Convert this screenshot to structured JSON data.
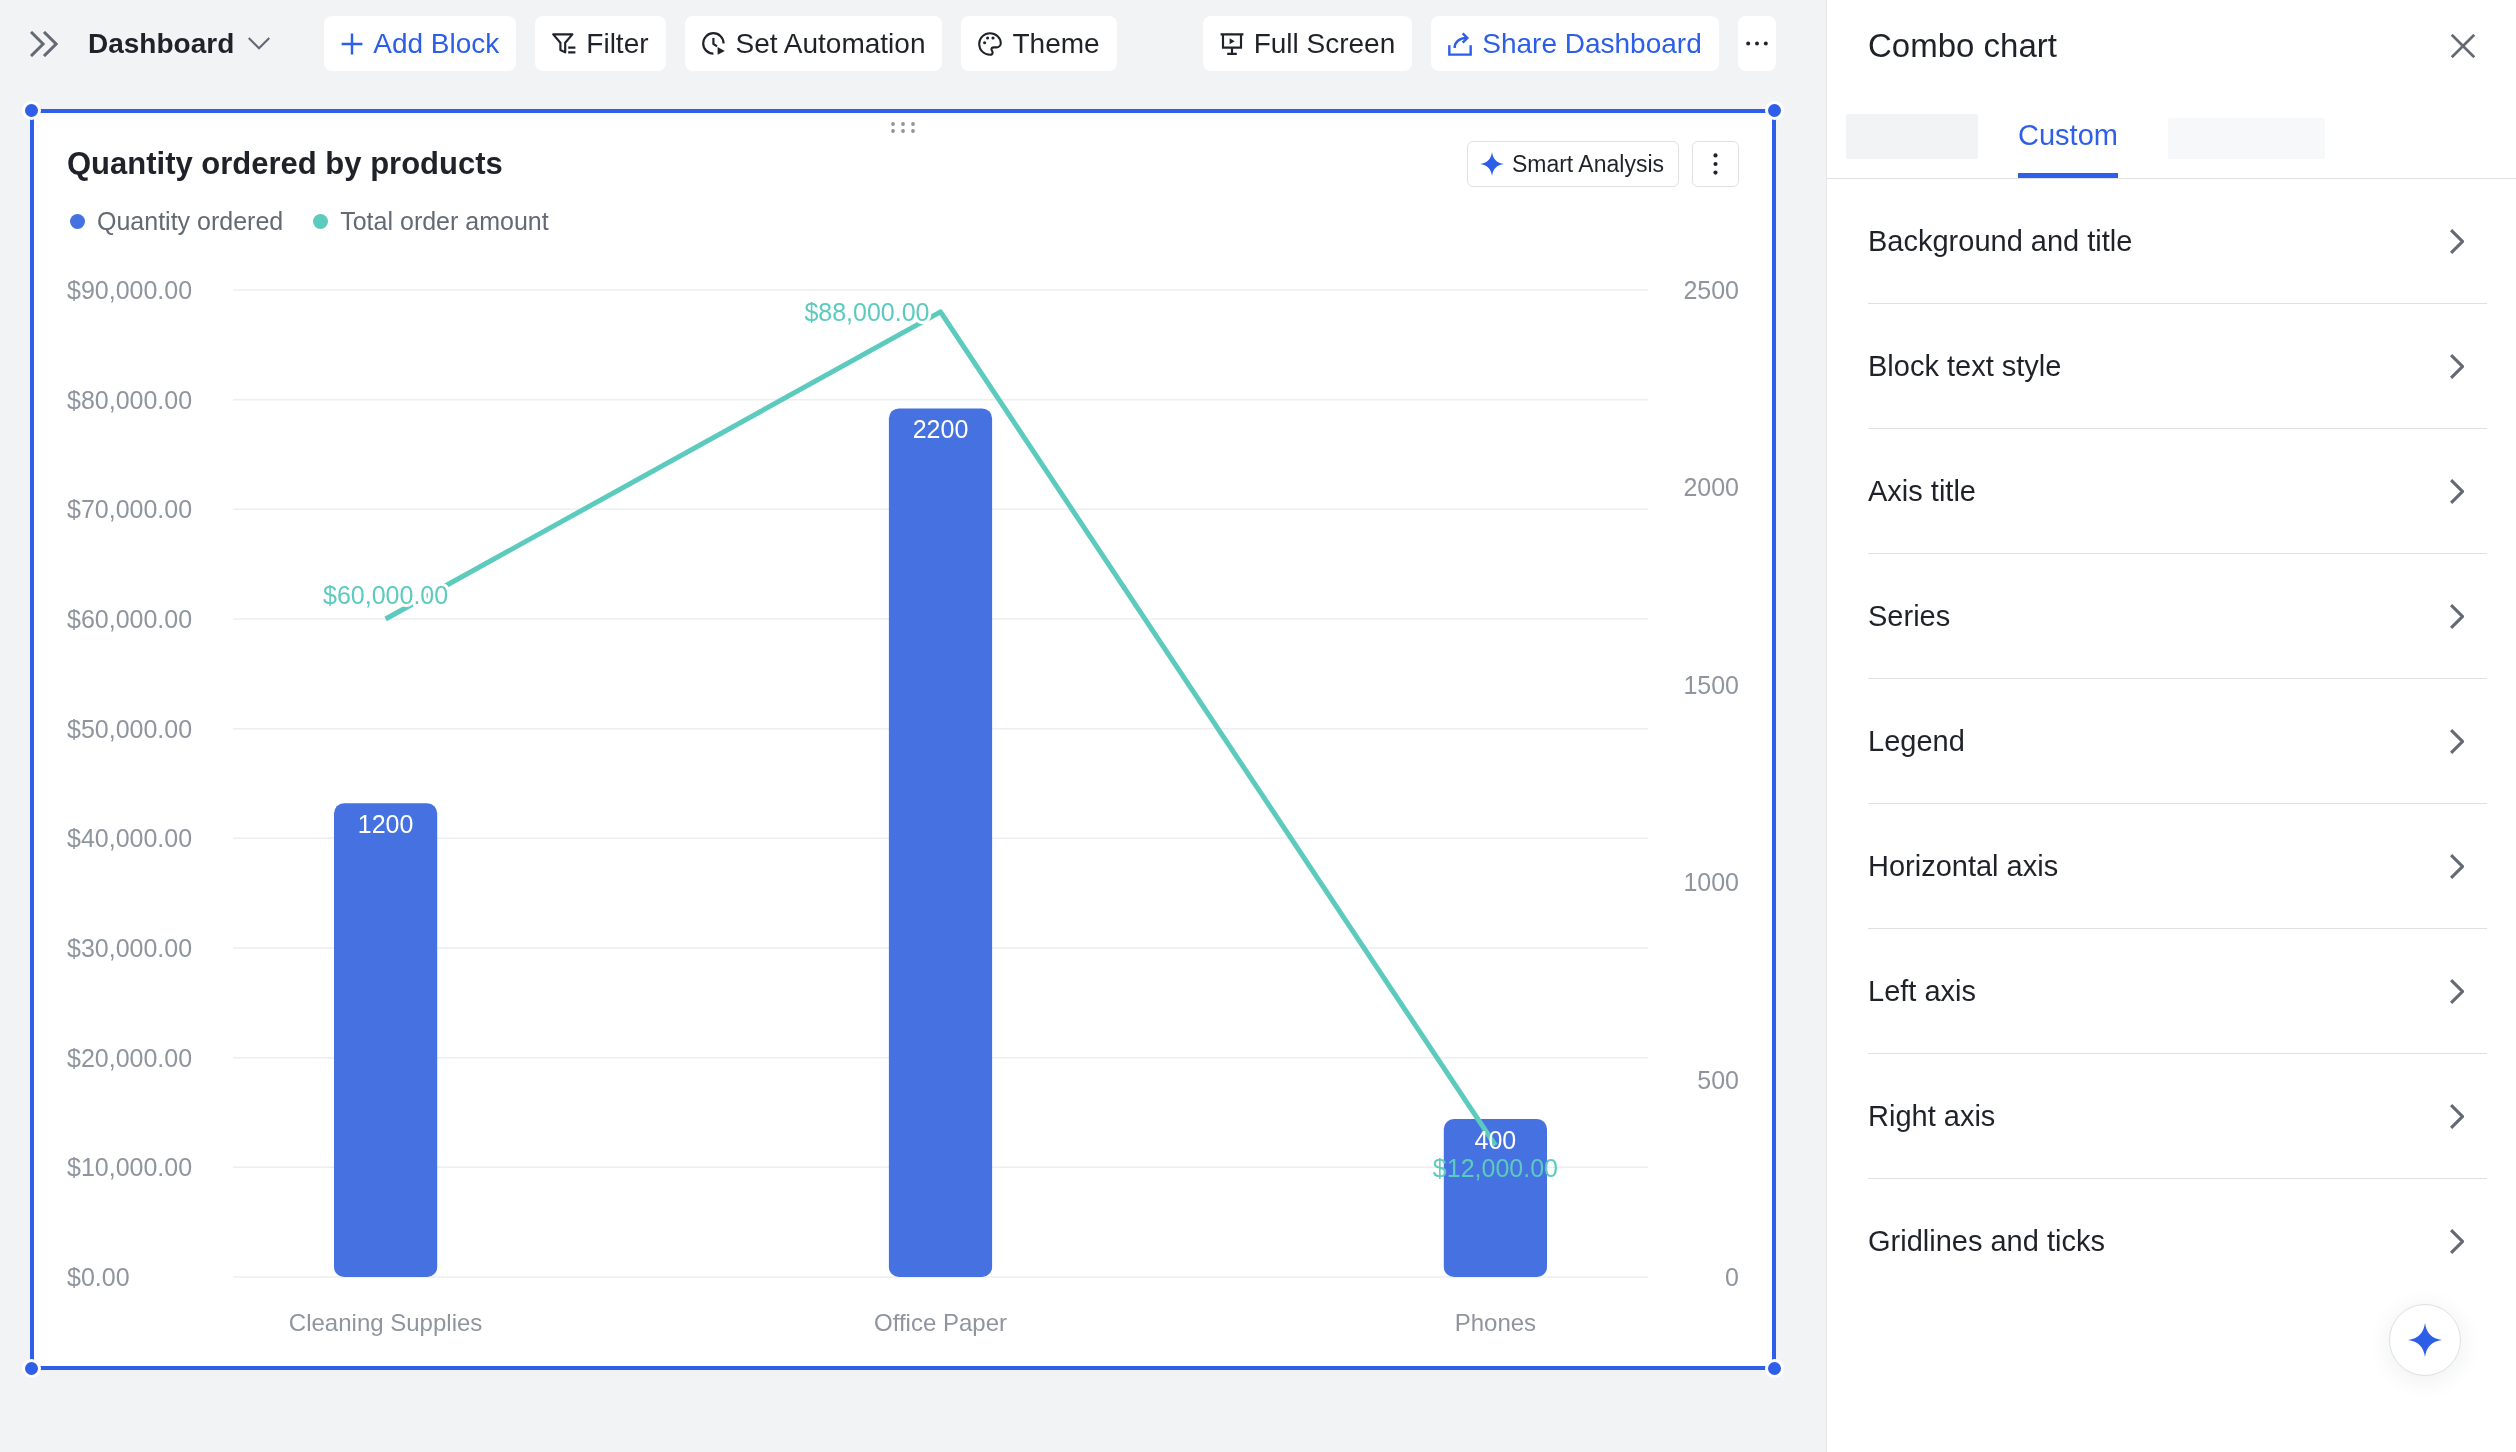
{
  "toolbar": {
    "dashboard_menu": "Dashboard",
    "left_buttons": [
      {
        "kind": "add",
        "label": "Add Block",
        "highlighted": true
      },
      {
        "kind": "filter",
        "label": "Filter",
        "highlighted": false
      },
      {
        "kind": "automation",
        "label": "Set Automation",
        "highlighted": false
      },
      {
        "kind": "theme",
        "label": "Theme",
        "highlighted": false
      }
    ],
    "right_buttons": [
      {
        "kind": "fullscreen",
        "label": "Full Screen",
        "highlighted": false
      },
      {
        "kind": "share",
        "label": "Share Dashboard",
        "highlighted": true
      }
    ]
  },
  "card": {
    "selected": true,
    "smart_analysis_button": "Smart Analysis",
    "chart_data": {
      "type": "bar",
      "title": "Quantity ordered by products",
      "legend": "top",
      "grid": true,
      "categories": [
        "Cleaning Supplies",
        "Office Paper",
        "Phones"
      ],
      "series": [
        {
          "name": "Quantity ordered",
          "axis": "y2",
          "color": "#4671e1",
          "values": [
            1200,
            2200,
            400
          ],
          "value_labels": [
            "1200",
            "2200",
            "400"
          ]
        },
        {
          "name": "Total order amount",
          "type": "line",
          "color": "#5ccbbd",
          "values": [
            60000,
            88000,
            12000
          ],
          "value_labels": [
            "$60,000.00",
            "$88,000.00",
            "$12,000.00"
          ]
        }
      ],
      "ylim": [
        0,
        90000
      ],
      "yticks": [
        {
          "value": 0,
          "label": "$0.00"
        },
        {
          "value": 10000,
          "label": "$10,000.00"
        },
        {
          "value": 20000,
          "label": "$20,000.00"
        },
        {
          "value": 30000,
          "label": "$30,000.00"
        },
        {
          "value": 40000,
          "label": "$40,000.00"
        },
        {
          "value": 50000,
          "label": "$50,000.00"
        },
        {
          "value": 60000,
          "label": "$60,000.00"
        },
        {
          "value": 70000,
          "label": "$70,000.00"
        },
        {
          "value": 80000,
          "label": "$80,000.00"
        },
        {
          "value": 90000,
          "label": "$90,000.00"
        }
      ],
      "y2lim": [
        0,
        2500
      ],
      "y2ticks": [
        0,
        500,
        1000,
        1500,
        2000,
        2500
      ],
      "data_labels": true
    }
  },
  "panel": {
    "title": "Combo chart",
    "tabs": [
      {
        "kind": "blurred",
        "selected": false
      },
      {
        "kind": "text",
        "label": "Custom",
        "selected": true
      },
      {
        "kind": "blurred",
        "selected": false
      }
    ],
    "sections": [
      "Background and title",
      "Block text style",
      "Axis title",
      "Series",
      "Legend",
      "Horizontal axis",
      "Left axis",
      "Right axis",
      "Gridlines and ticks"
    ]
  }
}
